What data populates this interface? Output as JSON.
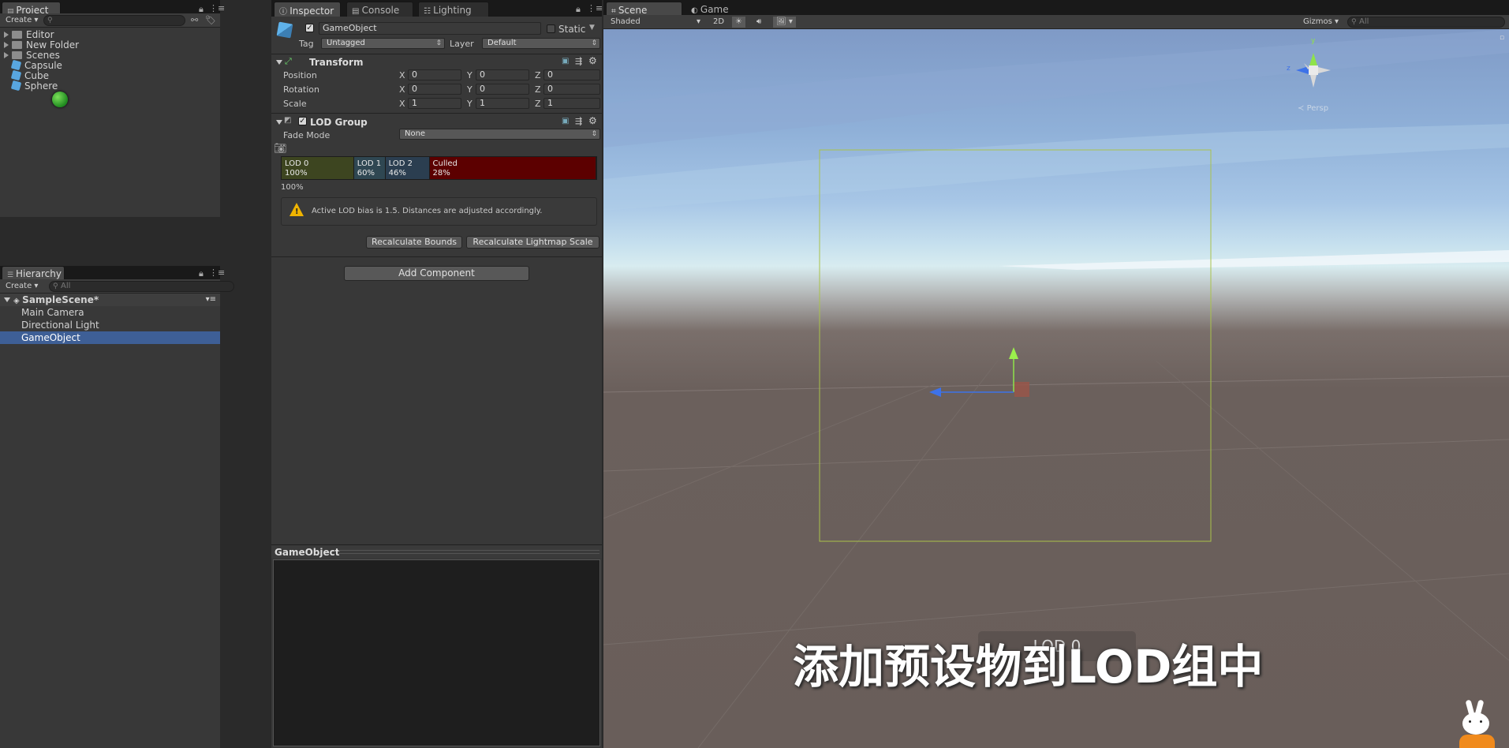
{
  "project": {
    "tab": "Project",
    "create": "Create",
    "items": [
      {
        "label": "Editor",
        "type": "folder"
      },
      {
        "label": "New Folder",
        "type": "folder"
      },
      {
        "label": "Scenes",
        "type": "folder"
      },
      {
        "label": "Capsule",
        "type": "prefab"
      },
      {
        "label": "Cube",
        "type": "prefab"
      },
      {
        "label": "Sphere",
        "type": "prefab"
      }
    ]
  },
  "hierarchy": {
    "tab": "Hierarchy",
    "create": "Create",
    "search_placeholder": "All",
    "scene": "SampleScene*",
    "items": [
      "Main Camera",
      "Directional Light",
      "GameObject"
    ]
  },
  "inspector": {
    "tabs": [
      "Inspector",
      "Console",
      "Lighting"
    ],
    "object_name": "GameObject",
    "static_label": "Static",
    "tag_label": "Tag",
    "tag_value": "Untagged",
    "layer_label": "Layer",
    "layer_value": "Default",
    "transform": {
      "title": "Transform",
      "rows": [
        {
          "label": "Position",
          "x": "0",
          "y": "0",
          "z": "0"
        },
        {
          "label": "Rotation",
          "x": "0",
          "y": "0",
          "z": "0"
        },
        {
          "label": "Scale",
          "x": "1",
          "y": "1",
          "z": "1"
        }
      ],
      "axis": [
        "X",
        "Y",
        "Z"
      ]
    },
    "lod_group": {
      "title": "LOD Group",
      "fade_mode_label": "Fade Mode",
      "fade_mode_value": "None",
      "levels": [
        {
          "name": "LOD 0",
          "percent": "100%",
          "color": "#3d4520",
          "share": 0.23
        },
        {
          "name": "LOD 1",
          "percent": "60%",
          "color": "#2f4752",
          "share": 0.1
        },
        {
          "name": "LOD 2",
          "percent": "46%",
          "color": "#2b3e50",
          "share": 0.14
        },
        {
          "name": "Culled",
          "percent": "28%",
          "color": "#5c0000",
          "share": 0.53
        }
      ],
      "current_percent": "100%",
      "warning": "Active LOD bias is 1.5. Distances are adjusted accordingly.",
      "recalc_bounds": "Recalculate Bounds",
      "recalc_lightmap": "Recalculate Lightmap Scale"
    },
    "add_component": "Add Component",
    "preview_title": "GameObject"
  },
  "scene": {
    "tabs": [
      "Scene",
      "Game"
    ],
    "shading": "Shaded",
    "mode_2d": "2D",
    "gizmos": "Gizmos",
    "search_placeholder": "All",
    "persp": "Persp",
    "gizmo_y": "y",
    "gizmo_z": "z",
    "overlay_tag": "LOD 0",
    "subtitle": "添加预设物到LOD组中"
  }
}
